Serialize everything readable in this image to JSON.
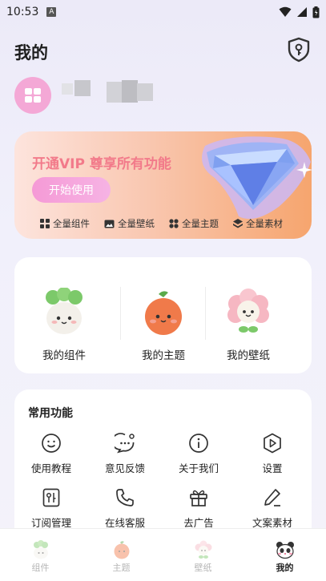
{
  "status_bar": {
    "time": "10:53",
    "notification_letter": "A"
  },
  "header": {
    "title": "我的"
  },
  "vip": {
    "title": "开通VIP 尊享所有功能",
    "start_button": "开始使用",
    "features": [
      {
        "label": "全量组件",
        "icon": "grid-icon"
      },
      {
        "label": "全量壁纸",
        "icon": "image-icon"
      },
      {
        "label": "全量主题",
        "icon": "theme-icon"
      },
      {
        "label": "全量素材",
        "icon": "layers-icon"
      }
    ]
  },
  "mine": {
    "items": [
      {
        "label": "我的组件",
        "icon": "radish-mascot-icon"
      },
      {
        "label": "我的主题",
        "icon": "peach-mascot-icon"
      },
      {
        "label": "我的壁纸",
        "icon": "flower-mascot-icon"
      }
    ]
  },
  "functions": {
    "title": "常用功能",
    "items": [
      {
        "label": "使用教程",
        "icon": "smile-icon"
      },
      {
        "label": "意见反馈",
        "icon": "chat-bubble-icon"
      },
      {
        "label": "关于我们",
        "icon": "info-icon"
      },
      {
        "label": "设置",
        "icon": "play-settings-icon"
      },
      {
        "label": "订阅管理",
        "icon": "subscription-icon"
      },
      {
        "label": "在线客服",
        "icon": "phone-icon"
      },
      {
        "label": "去广告",
        "icon": "gift-icon"
      },
      {
        "label": "文案素材",
        "icon": "pen-icon"
      }
    ]
  },
  "tabbar": {
    "tabs": [
      {
        "label": "组件",
        "active": false
      },
      {
        "label": "主题",
        "active": false
      },
      {
        "label": "壁纸",
        "active": false
      },
      {
        "label": "我的",
        "active": true
      }
    ]
  },
  "colors": {
    "accent_pink": "#f59ad6",
    "vip_title": "#f27a8a",
    "avatar_bg": "#f4a8d6"
  }
}
